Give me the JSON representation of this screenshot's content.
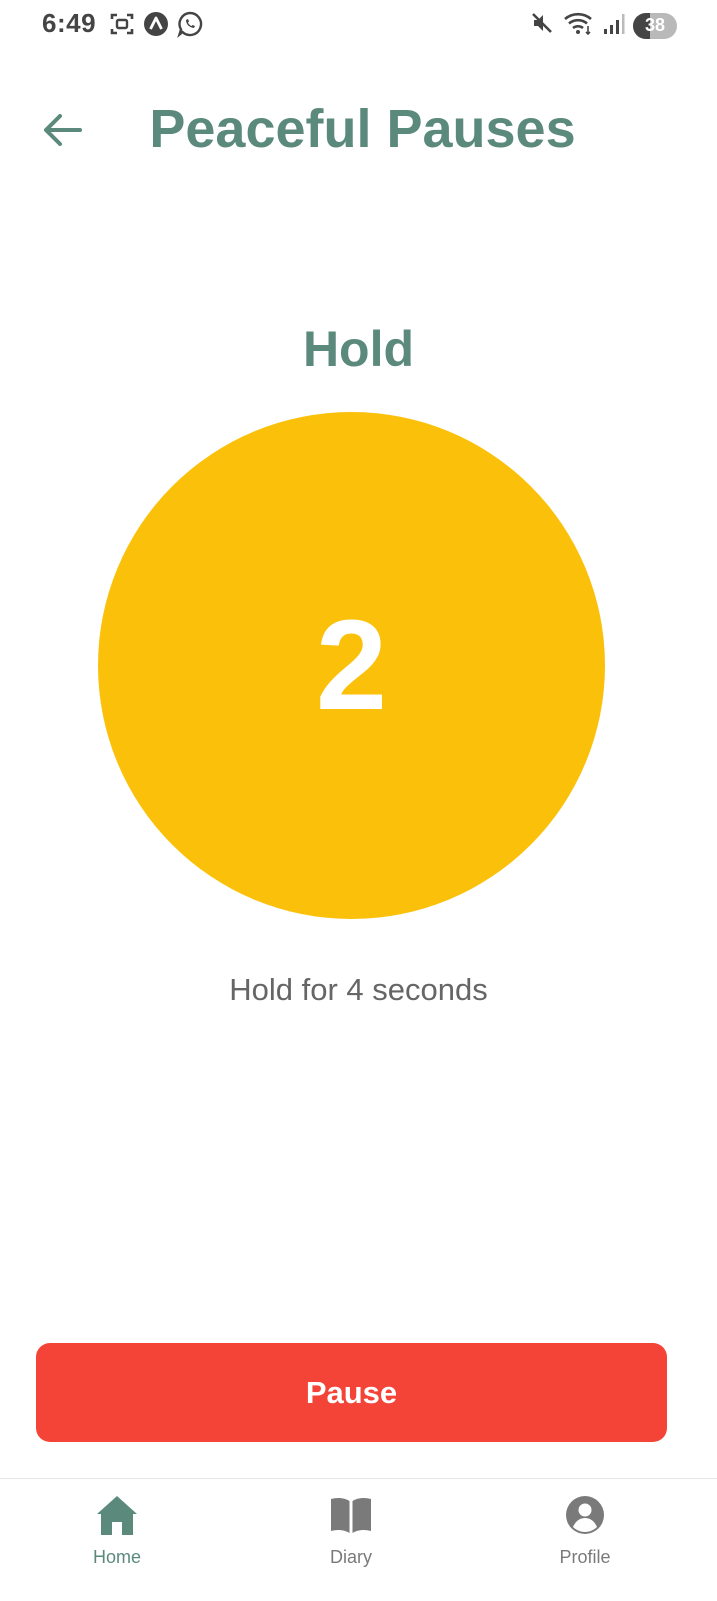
{
  "status_bar": {
    "time": "6:49",
    "battery_level": "38",
    "battery_fraction": 0.38,
    "left_icons": [
      "screenshot-icon",
      "app-a-icon",
      "whatsapp-icon"
    ],
    "right_icons": [
      "mute-icon",
      "wifi-icon",
      "signal-icon"
    ]
  },
  "header": {
    "title": "Peaceful Pauses",
    "back_icon": "arrow-left-icon"
  },
  "exercise": {
    "phase": "Hold",
    "countdown": "2",
    "instruction": "Hold for 4 seconds",
    "circle_color": "#FBC10A"
  },
  "controls": {
    "pause_label": "Pause",
    "pause_color": "#F44337"
  },
  "bottom_nav": {
    "items": [
      {
        "label": "Home",
        "icon": "home-icon",
        "active": true
      },
      {
        "label": "Diary",
        "icon": "book-icon",
        "active": false
      },
      {
        "label": "Profile",
        "icon": "profile-icon",
        "active": false
      }
    ]
  },
  "colors": {
    "accent": "#5B8A7D",
    "inactive": "#7A7A7A",
    "instruction_text": "#666666"
  }
}
